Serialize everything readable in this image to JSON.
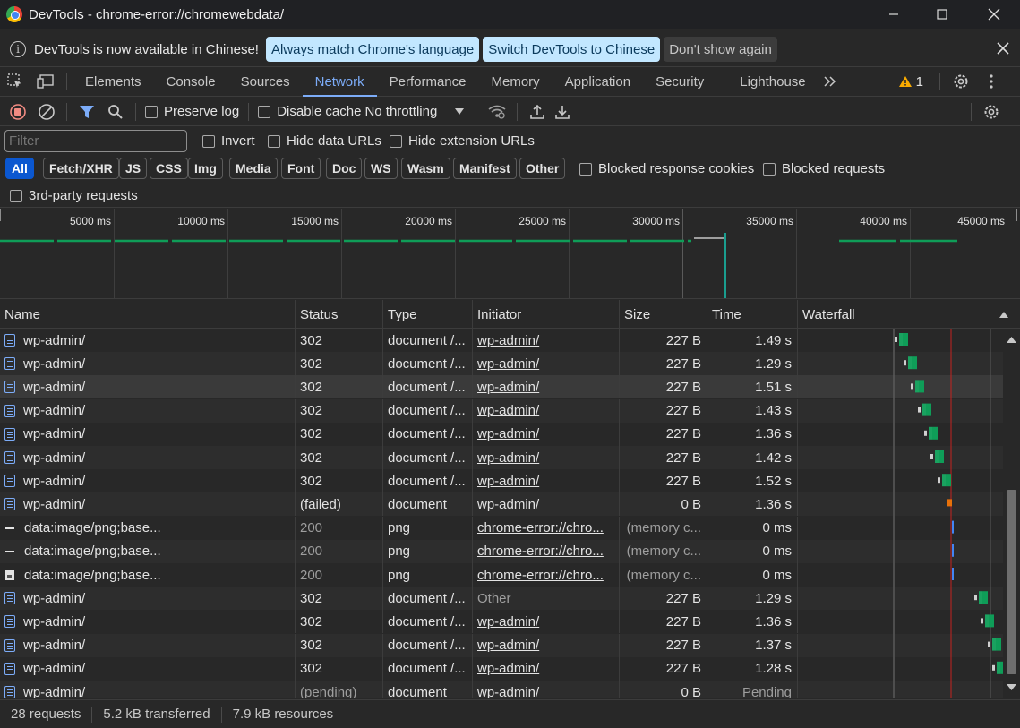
{
  "window": {
    "title": "DevTools - chrome-error://chromewebdata/"
  },
  "infobar": {
    "message": "DevTools is now available in Chinese!",
    "btn_match": "Always match Chrome's language",
    "btn_switch": "Switch DevTools to Chinese",
    "btn_dismiss": "Don't show again"
  },
  "tabs": [
    "Elements",
    "Console",
    "Sources",
    "Network",
    "Performance",
    "Memory",
    "Application",
    "Security",
    "Lighthouse"
  ],
  "active_tab": "Network",
  "warnings_count": "1",
  "toolbar": {
    "preserve_log": "Preserve log",
    "disable_cache": "Disable cache",
    "throttling": "No throttling"
  },
  "filter": {
    "placeholder": "Filter",
    "invert": "Invert",
    "hide_data_urls": "Hide data URLs",
    "hide_ext_urls": "Hide extension URLs",
    "types": [
      "All",
      "Fetch/XHR",
      "JS",
      "CSS",
      "Img",
      "Media",
      "Font",
      "Doc",
      "WS",
      "Wasm",
      "Manifest",
      "Other"
    ],
    "blocked_cookies": "Blocked response cookies",
    "blocked_requests": "Blocked requests",
    "third_party": "3rd-party requests"
  },
  "overview": {
    "ticks": [
      "5000 ms",
      "10000 ms",
      "15000 ms",
      "20000 ms",
      "25000 ms",
      "30000 ms",
      "35000 ms",
      "40000 ms",
      "45000 ms"
    ]
  },
  "columns": {
    "name": "Name",
    "status": "Status",
    "type": "Type",
    "initiator": "Initiator",
    "size": "Size",
    "time": "Time",
    "waterfall": "Waterfall"
  },
  "rows": [
    {
      "name": "wp-admin/",
      "icon": "document-icon",
      "status": "302",
      "type": "document /...",
      "initiator": "wp-admin/",
      "size": "227 B",
      "time": "1.49 s"
    },
    {
      "name": "wp-admin/",
      "icon": "document-icon",
      "status": "302",
      "type": "document /...",
      "initiator": "wp-admin/",
      "size": "227 B",
      "time": "1.29 s"
    },
    {
      "name": "wp-admin/",
      "icon": "document-icon",
      "status": "302",
      "type": "document /...",
      "initiator": "wp-admin/",
      "size": "227 B",
      "time": "1.51 s"
    },
    {
      "name": "wp-admin/",
      "icon": "document-icon",
      "status": "302",
      "type": "document /...",
      "initiator": "wp-admin/",
      "size": "227 B",
      "time": "1.43 s"
    },
    {
      "name": "wp-admin/",
      "icon": "document-icon",
      "status": "302",
      "type": "document /...",
      "initiator": "wp-admin/",
      "size": "227 B",
      "time": "1.36 s"
    },
    {
      "name": "wp-admin/",
      "icon": "document-icon",
      "status": "302",
      "type": "document /...",
      "initiator": "wp-admin/",
      "size": "227 B",
      "time": "1.42 s"
    },
    {
      "name": "wp-admin/",
      "icon": "document-icon",
      "status": "302",
      "type": "document /...",
      "initiator": "wp-admin/",
      "size": "227 B",
      "time": "1.52 s"
    },
    {
      "name": "wp-admin/",
      "icon": "document-icon",
      "status": "(failed)",
      "type": "document",
      "initiator": "wp-admin/",
      "size": "0 B",
      "time": "1.36 s"
    },
    {
      "name": "data:image/png;base...",
      "icon": "dash-icon",
      "status": "200",
      "type": "png",
      "initiator": "chrome-error://chro...",
      "size": "(memory c...",
      "time": "0 ms"
    },
    {
      "name": "data:image/png;base...",
      "icon": "dash-icon",
      "status": "200",
      "type": "png",
      "initiator": "chrome-error://chro...",
      "size": "(memory c...",
      "time": "0 ms"
    },
    {
      "name": "data:image/png;base...",
      "icon": "image-icon",
      "status": "200",
      "type": "png",
      "initiator": "chrome-error://chro...",
      "size": "(memory c...",
      "time": "0 ms"
    },
    {
      "name": "wp-admin/",
      "icon": "document-icon",
      "status": "302",
      "type": "document /...",
      "initiator": "Other",
      "size": "227 B",
      "time": "1.29 s"
    },
    {
      "name": "wp-admin/",
      "icon": "document-icon",
      "status": "302",
      "type": "document /...",
      "initiator": "wp-admin/",
      "size": "227 B",
      "time": "1.36 s"
    },
    {
      "name": "wp-admin/",
      "icon": "document-icon",
      "status": "302",
      "type": "document /...",
      "initiator": "wp-admin/",
      "size": "227 B",
      "time": "1.37 s"
    },
    {
      "name": "wp-admin/",
      "icon": "document-icon",
      "status": "302",
      "type": "document /...",
      "initiator": "wp-admin/",
      "size": "227 B",
      "time": "1.28 s"
    },
    {
      "name": "wp-admin/",
      "icon": "document-icon",
      "status": "(pending)",
      "type": "document",
      "initiator": "wp-admin/",
      "size": "0 B",
      "time": "Pending"
    }
  ],
  "status": {
    "requests": "28 requests",
    "transferred": "5.2 kB transferred",
    "resources": "7.9 kB resources"
  },
  "colors": {
    "accent": "#7cacf8",
    "chip_active": "#0b57d0",
    "waterfall_green": "#0f9d58",
    "waterfall_teal": "#1aa260",
    "failed_orange": "#e8710a",
    "data_blue": "#4285f4",
    "warning": "#f9ab00"
  }
}
